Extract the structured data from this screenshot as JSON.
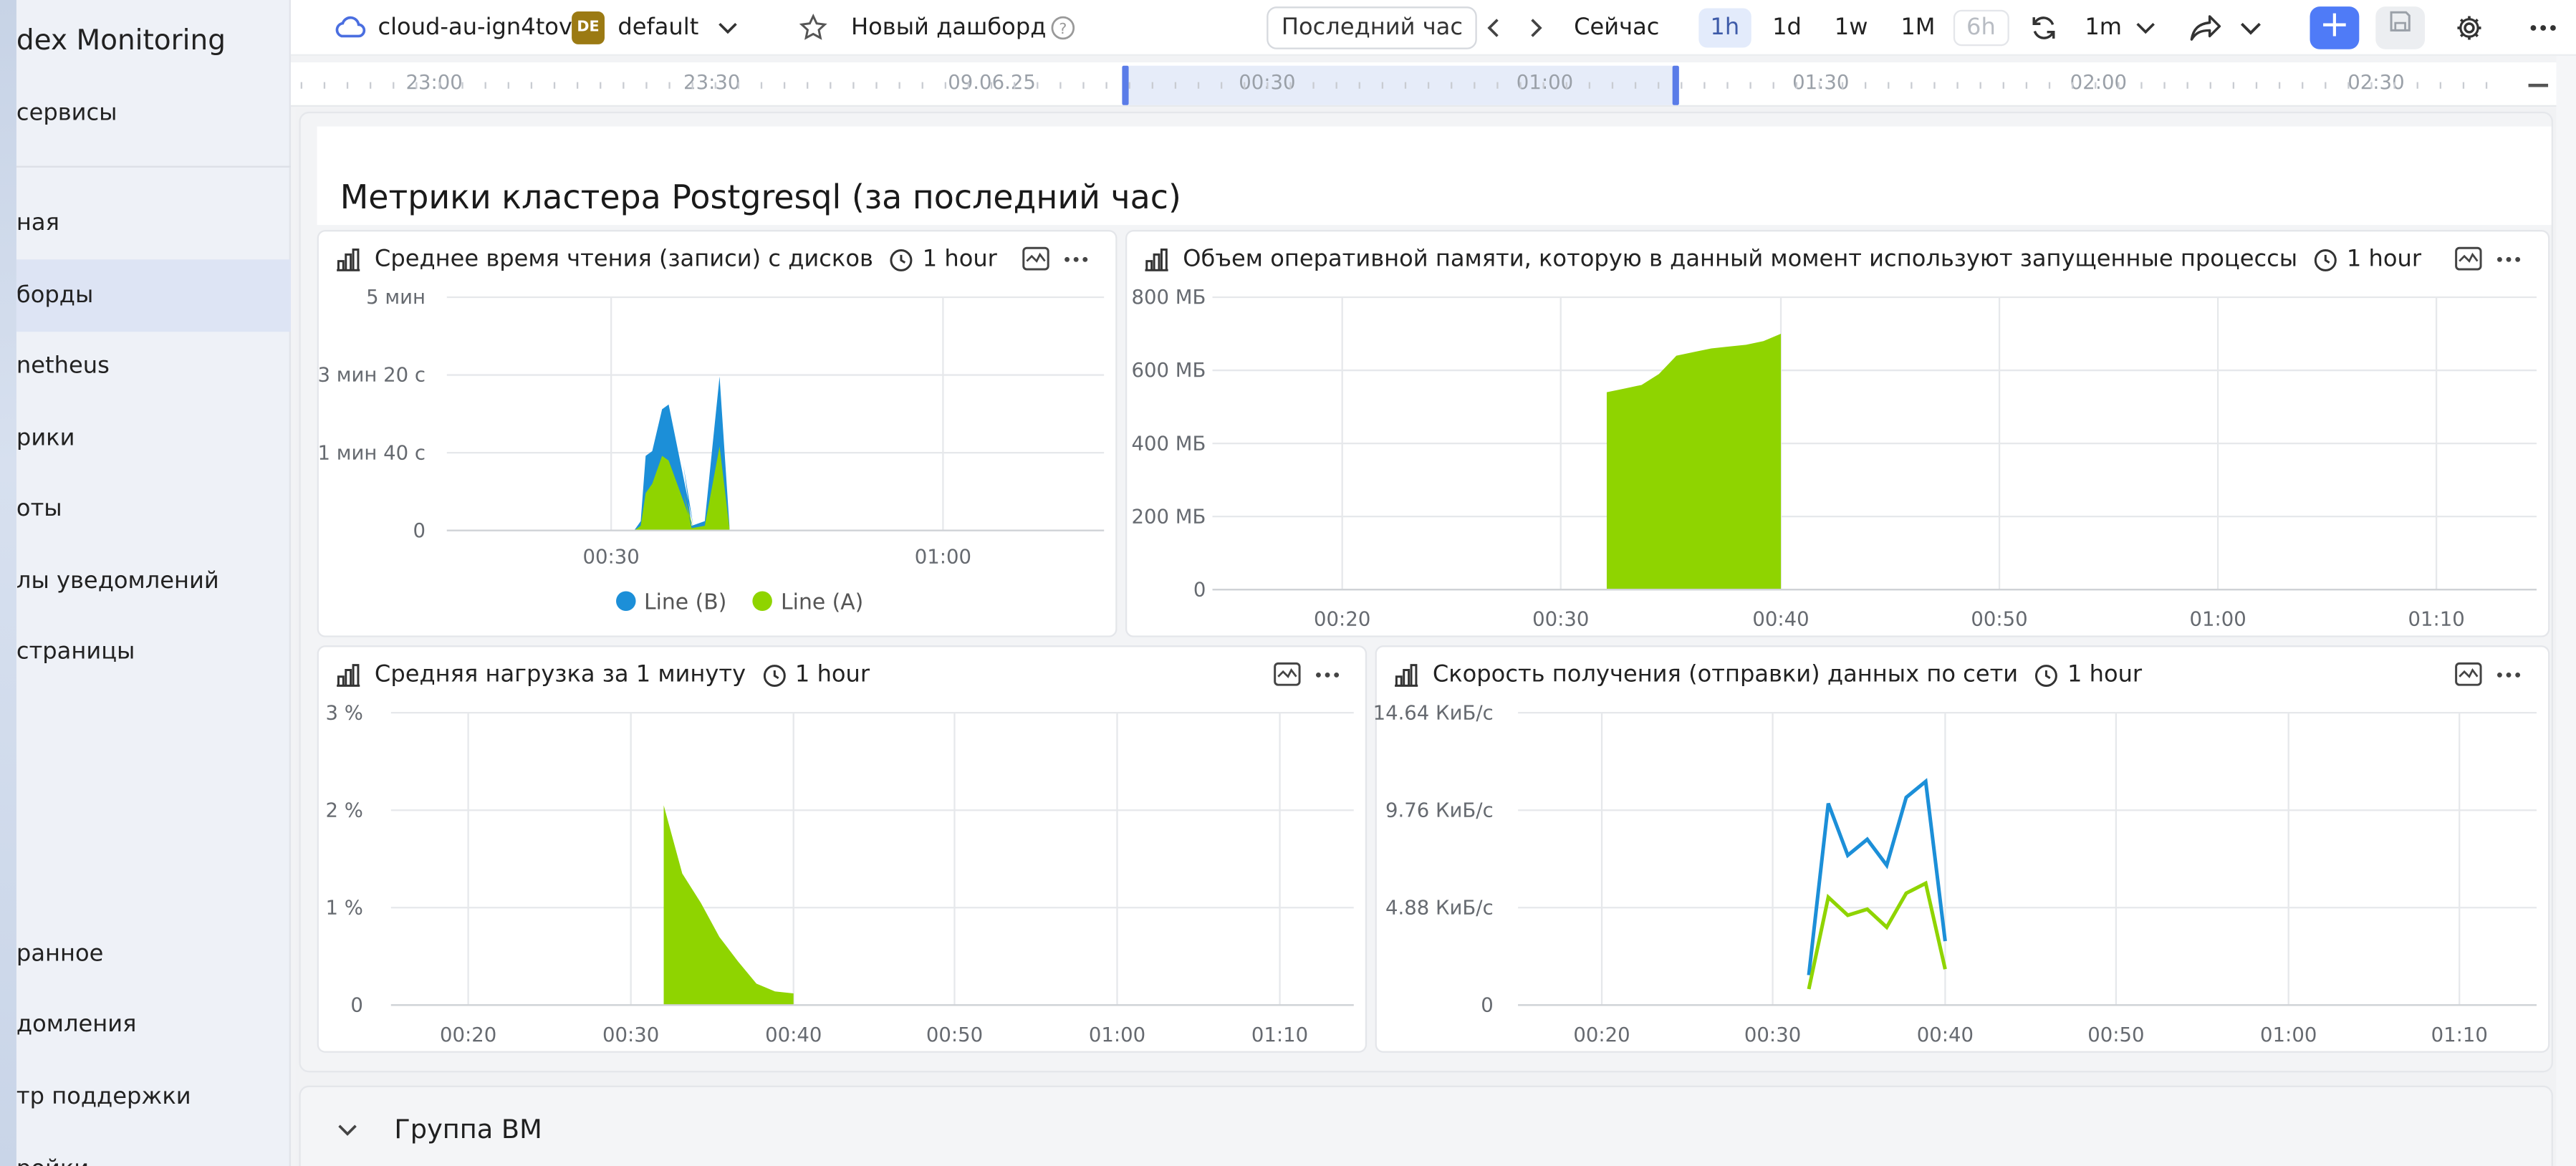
{
  "sidebar": {
    "title": "dex Monitoring",
    "items": [
      {
        "label": "сервисы"
      },
      {
        "label": "ная"
      },
      {
        "label": "борды"
      },
      {
        "label": "netheus"
      },
      {
        "label": "рики"
      },
      {
        "label": "оты"
      },
      {
        "label": "лы уведомлений"
      },
      {
        "label": "страницы"
      },
      {
        "label": "ранное"
      },
      {
        "label": "домления"
      },
      {
        "label": "тр поддержки"
      },
      {
        "label": "ройки"
      }
    ]
  },
  "topbar": {
    "cloud_name": "cloud-au-ign4tov",
    "folder_badge": "DE",
    "folder_name": "default",
    "dashboard_name": "Новый дашборд",
    "range_label": "Последний час",
    "now_label": "Сейчас",
    "ranges": [
      "1h",
      "1d",
      "1w",
      "1M",
      "6h"
    ],
    "refresh_interval": "1m"
  },
  "timeline": {
    "labels": [
      "23:00",
      "23:30",
      "09.06.25",
      "00:30",
      "01:00",
      "01:30",
      "02:00",
      "02:30"
    ]
  },
  "dashboard": {
    "title": "Метрики кластера Postgresql (за последний час)"
  },
  "widgets": [
    {
      "title": "Среднее время чтения (записи) с дисков",
      "range": "1 hour",
      "chart_data": {
        "type": "area",
        "y_ticks": [
          "5 мин",
          "3 мин 20 с",
          "1 мин 40 с",
          "0"
        ],
        "x_ticks": [
          "00:30",
          "01:00"
        ],
        "legend": [
          "Line (B)",
          "Line (A)"
        ],
        "colors": {
          "Line (B)": "#1c8fd8",
          "Line (A)": "#8fd400"
        },
        "series": [
          {
            "name": "Line (B)",
            "values": [
              0,
              0.2,
              1.6,
              1.7,
              2.6,
              2.7,
              0.1,
              1.4,
              0.1,
              0.2,
              3.3,
              0.1
            ]
          },
          {
            "name": "Line (A)",
            "values": [
              0,
              0.1,
              0.8,
              1.0,
              1.6,
              1.5,
              0.05,
              0.8,
              0.05,
              0.1,
              1.8,
              0.05
            ]
          }
        ]
      }
    },
    {
      "title": "Объем оперативной памяти, которую в данный момент используют запущенные процессы",
      "range": "1 hour",
      "chart_data": {
        "type": "area",
        "y_ticks": [
          "800 МБ",
          "600 МБ",
          "400 МБ",
          "200 МБ",
          "0"
        ],
        "x_ticks": [
          "00:20",
          "00:30",
          "00:40",
          "00:50",
          "01:00",
          "01:10"
        ],
        "colors": {
          "A": "#8fd400"
        },
        "series": [
          {
            "name": "",
            "values": [
              540,
              550,
              560,
              590,
              640,
              650,
              660,
              665,
              670,
              680,
              700
            ]
          }
        ]
      }
    },
    {
      "title": "Средняя нагрузка за 1 минуту",
      "range": "1 hour",
      "chart_data": {
        "type": "area",
        "y_ticks": [
          "3 %",
          "2 %",
          "1 %",
          "0"
        ],
        "x_ticks": [
          "00:20",
          "00:30",
          "00:40",
          "00:50",
          "01:00",
          "01:10"
        ],
        "colors": {
          "A": "#8fd400"
        },
        "series": [
          {
            "name": "",
            "values": [
              2.05,
              1.35,
              1.05,
              0.7,
              0.45,
              0.22,
              0.14,
              0.12
            ]
          }
        ]
      }
    },
    {
      "title": "Скорость получения (отправки) данных по сети",
      "range": "1 hour",
      "chart_data": {
        "type": "line",
        "y_ticks": [
          "14.64 КиБ/с",
          "9.76 КиБ/с",
          "4.88 КиБ/с",
          "0"
        ],
        "x_ticks": [
          "00:20",
          "00:30",
          "00:40",
          "00:50",
          "01:00",
          "01:10"
        ],
        "colors": {
          "B": "#1c8fd8",
          "A": "#8fd400"
        },
        "series": [
          {
            "name": "",
            "values": [
              1.5,
              10.1,
              7.5,
              8.3,
              7.0,
              10.4,
              11.2,
              3.2
            ]
          },
          {
            "name": "",
            "values": [
              0.8,
              5.4,
              4.5,
              4.8,
              3.9,
              5.6,
              6.1,
              1.8
            ]
          }
        ]
      }
    }
  ],
  "group": {
    "title": "Группа ВМ"
  }
}
